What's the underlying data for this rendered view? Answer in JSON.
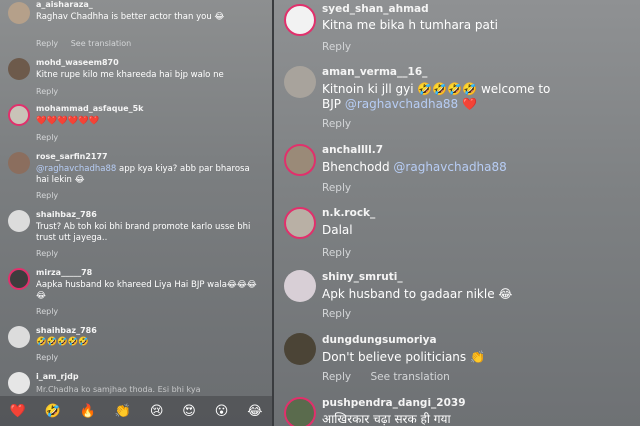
{
  "left": {
    "comments": [
      {
        "user": "a_aisharaza_",
        "text": "Raghav Chadhha is better actor than you 😂",
        "reply": "Reply",
        "see_translation": "See translation",
        "avatar_color": "#b5a08a"
      },
      {
        "user": "mohd_waseem870",
        "text": "Kitne rupe kilo me khareeda hai bjp walo ne",
        "reply": "Reply",
        "avatar_color": "#6d5a4b"
      },
      {
        "user": "mohammad_asfaque_5k",
        "text": "❤️❤️❤️❤️❤️❤️",
        "reply": "Reply",
        "avatar_color": "#c9c3b8"
      },
      {
        "user": "rose_sarfin2177",
        "mention": "@raghavchadha88",
        "text": " app kya kiya? abb par bharosa hai lekin 😂",
        "reply": "Reply",
        "avatar_color": "#8b6e5e"
      },
      {
        "user": "shaihbaz_786",
        "text": "Trust? Ab toh koi bhi brand promote karlo usse bhi trust utt jayega..",
        "reply": "Reply",
        "avatar_color": "#dcdcdc"
      },
      {
        "user": "mirza_____78",
        "text": "Aapka husband ko khareed Liya Hai BJP wala😂😂😂😂",
        "reply": "Reply",
        "avatar_color": "#3d3d3d"
      },
      {
        "user": "shaihbaz_786",
        "text": "🤣🤣🤣🤣🤣",
        "reply": "Reply",
        "avatar_color": "#dcdcdc"
      },
      {
        "user": "i_am_rjdp",
        "text": "Mr.Chadha ko samjhao thoda. Esi bhi kya",
        "avatar_color": "#e6e6e6"
      }
    ],
    "emoji_bar": [
      "❤️",
      "🤣",
      "🔥",
      "👏",
      "😢",
      "😍",
      "😮",
      "😂"
    ]
  },
  "right": {
    "comments": [
      {
        "user": "syed_shan_ahmad",
        "text": "Kitna me bika h tumhara pati",
        "reply": "Reply",
        "avatar_color": "#f2f2f2"
      },
      {
        "user": "aman_verma__16_",
        "text": "Kitnoin ki jll gyi 🤣🤣🤣🤣 welcome to",
        "text2_prefix": "BJP ",
        "mention": "@raghavchadha88",
        "text2_suffix": " ❤️",
        "reply": "Reply",
        "avatar_color": "#a8a39c"
      },
      {
        "user": "anchallll.7",
        "text": "Bhenchodd ",
        "mention": "@raghavchadha88",
        "reply": "Reply",
        "avatar_color": "#9a8a78"
      },
      {
        "user": "n.k.rock_",
        "text": "Dalal",
        "reply": "Reply",
        "avatar_color": "#b9b0a5"
      },
      {
        "user": "shiny_smruti_",
        "text": "Apk husband to gadaar nikle 😂",
        "reply": "Reply",
        "avatar_color": "#d8cfd6"
      },
      {
        "user": "dungdungsumoriya",
        "text": "Don't believe politicians 👏",
        "reply": "Reply",
        "see_translation": "See translation",
        "avatar_color": "#4b4436"
      },
      {
        "user": "pushpendra_dangi_2039",
        "text": "आखिरकार चढ़ा सरक ही गया",
        "avatar_color": "#5a6b4d"
      }
    ]
  }
}
